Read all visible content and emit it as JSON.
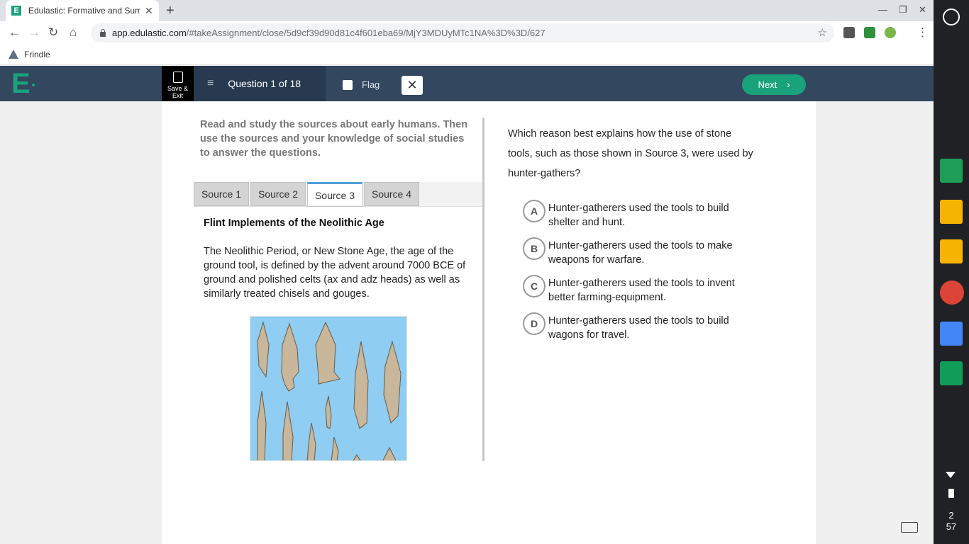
{
  "browser": {
    "tab_title": "Edulastic: Formative and Summ",
    "tab_favicon": "E",
    "url_domain": "app.edulastic.com",
    "url_path": "/#takeAssignment/close/5d9cf39d90d81c4f601eba69/MjY3MDUyMTc1NA%3D%3D/627",
    "bookmark": "Frindle"
  },
  "header": {
    "save_exit": "Save & Exit",
    "question_label": "Question 1 of 18",
    "flag_label": "Flag",
    "next_label": "Next"
  },
  "passage": {
    "instructions": "Read and study the sources about early humans. Then use the sources and your knowledge of social studies to answer the questions.",
    "tabs": [
      "Source 1",
      "Source 2",
      "Source 3",
      "Source 4"
    ],
    "active_tab": "Source 3",
    "source_title": "Flint Implements of the Neolithic Age",
    "source_body": "The Neolithic Period, or New Stone Age, the age of the ground tool, is defined by the advent around 7000 BCE of ground and polished celts (ax and adz heads) as well as similarly treated chisels and gouges."
  },
  "question": {
    "stem": "Which reason best explains how the use of stone tools, such as those shown in Source 3, were used by hunter-gathers?",
    "options": [
      {
        "letter": "A",
        "text": "Hunter-gatherers used the tools to build shelter and hunt."
      },
      {
        "letter": "B",
        "text": "Hunter-gatherers used the tools to make weapons for warfare."
      },
      {
        "letter": "C",
        "text": "Hunter-gatherers used the tools to invent better farming-equipment."
      },
      {
        "letter": "D",
        "text": "Hunter-gatherers used the tools to build wagons for travel."
      }
    ]
  },
  "shelf": {
    "time_hour": "2",
    "time_min": "57",
    "apps": [
      "sheets-icon",
      "classroom-icon",
      "slides-icon",
      "chrome-icon",
      "docs-icon",
      "drive-icon"
    ]
  },
  "colors": {
    "brand_green": "#1aa37a",
    "header_bg": "#33475e",
    "tab_active": "#4e9fd4"
  }
}
